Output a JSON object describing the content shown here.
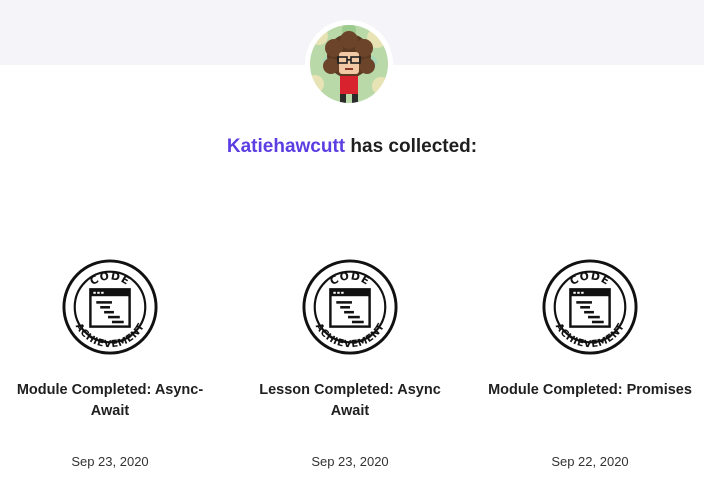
{
  "profile": {
    "username": "Katiehawcutt",
    "collected_suffix": "has collected:"
  },
  "badge_ring_text": {
    "top": "CODE",
    "bottom": "ACHIEVEMENT"
  },
  "achievements": [
    {
      "title": "Module Completed: Async-Await",
      "date": "Sep 23, 2020"
    },
    {
      "title": "Lesson Completed: Async Await",
      "date": "Sep 23, 2020"
    },
    {
      "title": "Module Completed: Promises",
      "date": "Sep 22, 2020"
    }
  ],
  "colors": {
    "username_accent": "#5c3ee2",
    "header_band": "#f5f4f9"
  }
}
